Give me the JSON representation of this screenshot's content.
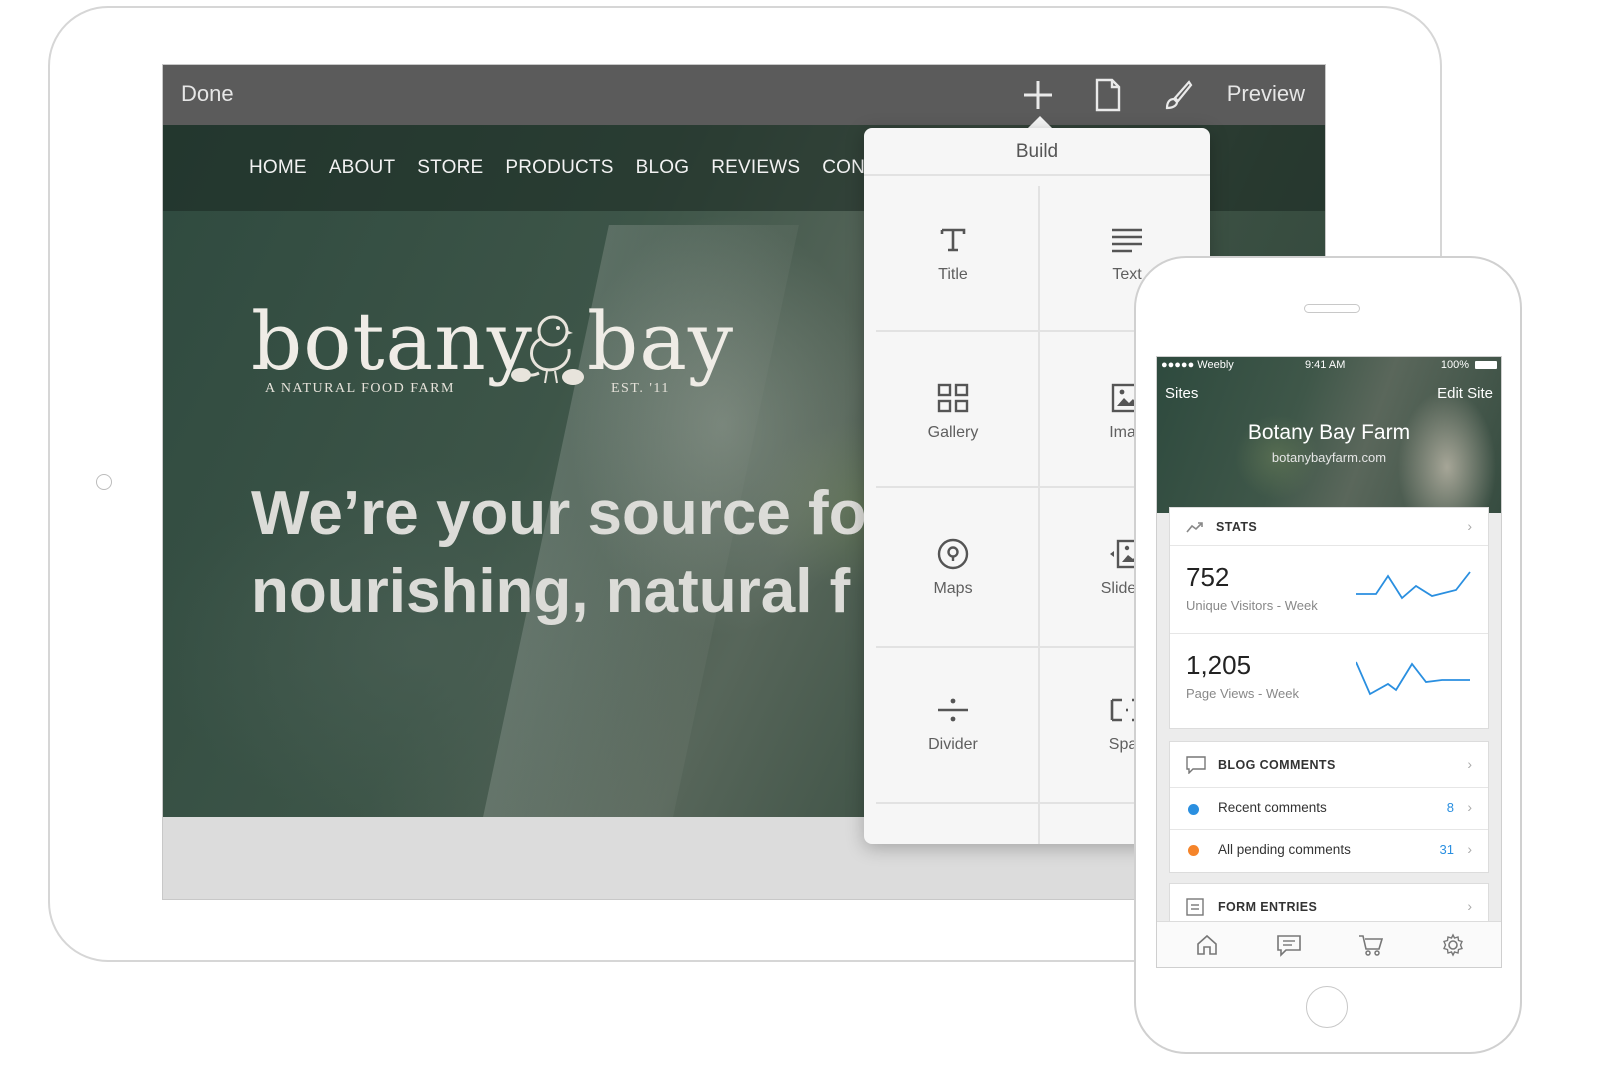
{
  "editor": {
    "done_label": "Done",
    "preview_label": "Preview",
    "tools": [
      "add-icon",
      "page-icon",
      "brush-icon"
    ]
  },
  "site": {
    "nav": [
      "HOME",
      "ABOUT",
      "STORE",
      "PRODUCTS",
      "BLOG",
      "REVIEWS",
      "CONTACT"
    ],
    "logo_word_1": "botany",
    "logo_word_2": "bay",
    "logo_sub_left": "A NATURAL FOOD FARM",
    "logo_sub_right": "EST. '11",
    "tagline_line1": "We’re your source fo",
    "tagline_line2": "nourishing, natural f"
  },
  "build": {
    "title": "Build",
    "items": [
      {
        "label": "Title",
        "icon": "title-icon"
      },
      {
        "label": "Text",
        "icon": "text-icon"
      },
      {
        "label": "Gallery",
        "icon": "gallery-icon"
      },
      {
        "label": "Imag",
        "icon": "image-icon"
      },
      {
        "label": "Maps",
        "icon": "map-pin-icon"
      },
      {
        "label": "Slidesh",
        "icon": "slideshow-icon"
      },
      {
        "label": "Divider",
        "icon": "divider-icon"
      },
      {
        "label": "Spac",
        "icon": "spacer-icon"
      }
    ]
  },
  "phone": {
    "status": {
      "carrier": "●●●●● Weebly",
      "time": "9:41 AM",
      "battery": "100%"
    },
    "sites_label": "Sites",
    "edit_label": "Edit Site",
    "site_title": "Botany Bay Farm",
    "site_domain": "botanybayfarm.com",
    "stats": {
      "title": "STATS",
      "visitors_value": "752",
      "visitors_label": "Unique Visitors - Week",
      "views_value": "1,205",
      "views_label": "Page Views - Week"
    },
    "blog": {
      "title": "BLOG COMMENTS",
      "recent_label": "Recent comments",
      "recent_count": "8",
      "pending_label": "All pending comments",
      "pending_count": "31",
      "recent_color": "#2a8fe0",
      "pending_color": "#f5842a"
    },
    "forms": {
      "title": "FORM ENTRIES"
    },
    "tabs": [
      "home-icon",
      "comments-icon",
      "cart-icon",
      "settings-icon"
    ]
  },
  "colors": {
    "accent_blue": "#2a8fe0",
    "editor_bar": "#5b5b5b"
  }
}
